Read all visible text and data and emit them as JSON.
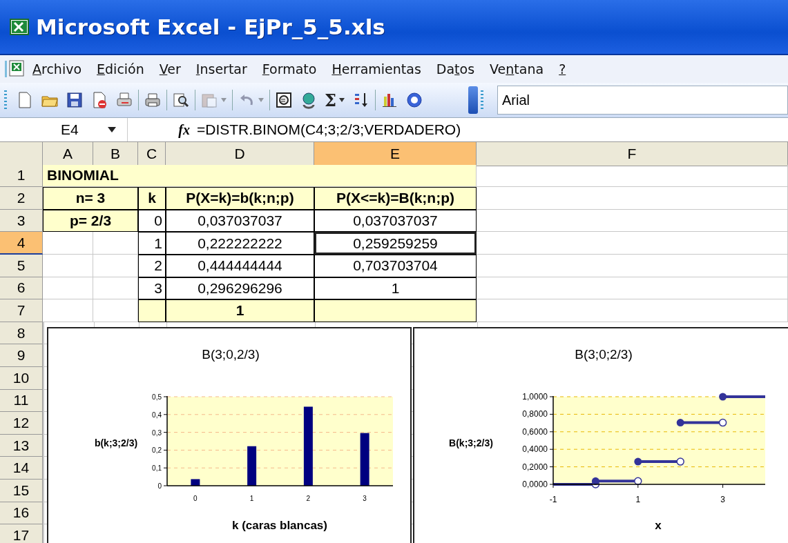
{
  "window": {
    "title": "Microsoft Excel - EjPr_5_5.xls"
  },
  "menu": [
    {
      "key": "A",
      "after": "rchivo"
    },
    {
      "key": "E",
      "after": "dición"
    },
    {
      "key": "V",
      "after": "er"
    },
    {
      "key": "I",
      "after": "nsertar"
    },
    {
      "key": "F",
      "after": "ormato"
    },
    {
      "key": "H",
      "after": "erramientas"
    },
    {
      "before": "Da",
      "key": "t",
      "after": "os"
    },
    {
      "before": "Ve",
      "key": "n",
      "after": "tana"
    },
    {
      "key": "?"
    }
  ],
  "toolbar": [
    {
      "kind": "button",
      "disabled": false
    },
    {
      "kind": "button",
      "disabled": false
    },
    {
      "kind": "button",
      "disabled": false
    },
    {
      "kind": "button",
      "disabled": false
    },
    {
      "kind": "button",
      "disabled": false
    },
    {
      "kind": "separator"
    },
    {
      "kind": "button",
      "disabled": false
    },
    {
      "kind": "separator"
    },
    {
      "kind": "button",
      "disabled": false
    },
    {
      "kind": "separator"
    },
    {
      "kind": "split",
      "disabled": true
    },
    {
      "kind": "separator"
    },
    {
      "kind": "split",
      "disabled": true
    },
    {
      "kind": "separator"
    },
    {
      "kind": "button",
      "disabled": false
    },
    {
      "kind": "button",
      "disabled": false
    },
    {
      "kind": "text-split",
      "text": "Σ",
      "disabled": false
    },
    {
      "kind": "button",
      "disabled": false
    },
    {
      "kind": "separator"
    },
    {
      "kind": "button",
      "disabled": false
    },
    {
      "kind": "button",
      "disabled": false
    }
  ],
  "font_box": {
    "value": "Arial"
  },
  "formula_bar": {
    "name_box": "E4",
    "function_button": "fx",
    "formula": "=DISTR.BINOM(C4;3;2/3;VERDADERO)"
  },
  "sheet": {
    "columns": [
      {
        "label": "A",
        "selected": false
      },
      {
        "label": "B",
        "selected": false
      },
      {
        "label": "C",
        "selected": false
      },
      {
        "label": "D",
        "selected": false
      },
      {
        "label": "E",
        "selected": true
      },
      {
        "label": "F",
        "selected": false
      }
    ],
    "rows": [
      {
        "label": "1",
        "selected": false,
        "cells": [
          {
            "kind": "title",
            "text": "BINOMIAL"
          }
        ]
      },
      {
        "label": "2",
        "selected": false,
        "cells": [
          {
            "kind": "param",
            "text": "n= 3"
          },
          {
            "kind": "header",
            "text": "k"
          },
          {
            "kind": "header",
            "text": "P(X=k)=b(k;n;p)"
          },
          {
            "kind": "header",
            "text": "P(X<=k)=B(k;n;p)"
          }
        ]
      },
      {
        "label": "3",
        "selected": false,
        "cells": [
          {
            "kind": "param",
            "text": "p= 2/3"
          },
          {
            "kind": "index",
            "text": "0"
          },
          {
            "kind": "value",
            "text": "0,037037037",
            "selected": false
          },
          {
            "kind": "value",
            "text": "0,037037037",
            "selected": false
          }
        ]
      },
      {
        "label": "4",
        "selected": true,
        "cells": [
          {
            "kind": "empty"
          },
          {
            "kind": "empty"
          },
          {
            "kind": "index",
            "text": "1"
          },
          {
            "kind": "value",
            "text": "0,222222222",
            "selected": false
          },
          {
            "kind": "value",
            "text": "0,259259259",
            "selected": true
          }
        ]
      },
      {
        "label": "5",
        "selected": false,
        "cells": [
          {
            "kind": "empty"
          },
          {
            "kind": "empty"
          },
          {
            "kind": "index",
            "text": "2"
          },
          {
            "kind": "value",
            "text": "0,444444444",
            "selected": false
          },
          {
            "kind": "value",
            "text": "0,703703704",
            "selected": false
          }
        ]
      },
      {
        "label": "6",
        "selected": false,
        "cells": [
          {
            "kind": "empty"
          },
          {
            "kind": "empty"
          },
          {
            "kind": "index",
            "text": "3"
          },
          {
            "kind": "value",
            "text": "0,296296296",
            "selected": false
          },
          {
            "kind": "value",
            "text": "1",
            "selected": false
          }
        ]
      },
      {
        "label": "7",
        "selected": false,
        "cells": [
          {
            "kind": "empty"
          },
          {
            "kind": "empty"
          },
          {
            "kind": "total"
          },
          {
            "kind": "total",
            "text": "1"
          },
          {
            "kind": "total"
          }
        ]
      },
      {
        "label": "8",
        "selected": false
      },
      {
        "label": "9",
        "selected": false
      },
      {
        "label": "10",
        "selected": false
      },
      {
        "label": "11",
        "selected": false
      },
      {
        "label": "12",
        "selected": false
      },
      {
        "label": "13",
        "selected": false
      },
      {
        "label": "14",
        "selected": false
      },
      {
        "label": "15",
        "selected": false
      },
      {
        "label": "16",
        "selected": false
      },
      {
        "label": "17",
        "selected": false
      }
    ]
  },
  "charts": [
    {
      "chart_data": {
        "type": "bar",
        "title": "B(3;0,2/3)",
        "xlabel": "k (caras blancas)",
        "ylabel": "b(k;3;2/3)",
        "categories": [
          "0",
          "1",
          "2",
          "3"
        ],
        "series": [
          {
            "color": "#000080",
            "values": [
              0.037,
              0.222,
              0.444,
              0.296
            ]
          }
        ],
        "grid": true,
        "ylim": [
          0,
          0.5
        ],
        "yticks": [
          {
            "value": 0,
            "label": "0"
          },
          {
            "value": 0.1,
            "label": "0,1"
          },
          {
            "value": 0.2,
            "label": "0,2"
          },
          {
            "value": 0.3,
            "label": "0,3"
          },
          {
            "value": 0.4,
            "label": "0,4"
          },
          {
            "value": 0.5,
            "label": "0,5"
          }
        ]
      }
    },
    {
      "chart_data": {
        "type": "line",
        "title": "B(3;0;2/3)",
        "xlabel": "x",
        "ylabel": "B(k;3;2/3)",
        "x": [
          -1,
          0,
          null,
          0,
          1,
          null,
          1,
          2,
          null,
          2,
          3,
          null,
          3,
          4
        ],
        "series": [
          {
            "color": "#333399",
            "marker": true,
            "values": [
              0,
              0,
              null,
              0.037,
              0.037,
              null,
              0.259,
              0.259,
              null,
              0.704,
              0.704,
              null,
              1,
              1
            ]
          }
        ],
        "grid": true,
        "xlim": [
          -1,
          4
        ],
        "ylim": [
          0,
          1
        ],
        "xticks": [
          -1,
          1,
          3
        ],
        "yticks": [
          {
            "value": 0,
            "label": "0,0000"
          },
          {
            "value": 0.2,
            "label": "0,2000"
          },
          {
            "value": 0.4,
            "label": "0,4000"
          },
          {
            "value": 0.6,
            "label": "0,6000"
          },
          {
            "value": 0.8,
            "label": "0,8000"
          },
          {
            "value": 1,
            "label": "1,0000"
          }
        ]
      }
    }
  ]
}
